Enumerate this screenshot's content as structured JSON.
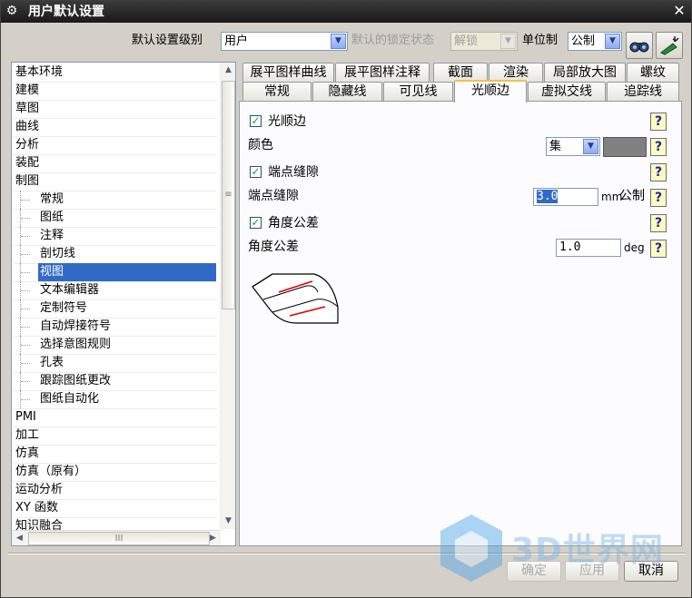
{
  "window": {
    "title": "用户默认设置",
    "close": "✕"
  },
  "toolbar": {
    "level_label": "默认设置级别",
    "level_value": "用户",
    "lock_label": "默认的锁定状态",
    "lock_value": "解锁",
    "unit_label": "单位制",
    "unit_value": "公制"
  },
  "tree": {
    "items": [
      {
        "label": "基本环境",
        "indent": 0
      },
      {
        "label": "建模",
        "indent": 0
      },
      {
        "label": "草图",
        "indent": 0
      },
      {
        "label": "曲线",
        "indent": 0
      },
      {
        "label": "分析",
        "indent": 0
      },
      {
        "label": "装配",
        "indent": 0
      },
      {
        "label": "制图",
        "indent": 0
      },
      {
        "label": "常规",
        "indent": 1
      },
      {
        "label": "图纸",
        "indent": 1
      },
      {
        "label": "注释",
        "indent": 1
      },
      {
        "label": "剖切线",
        "indent": 1
      },
      {
        "label": "视图",
        "indent": 1,
        "selected": true
      },
      {
        "label": "文本编辑器",
        "indent": 1
      },
      {
        "label": "定制符号",
        "indent": 1
      },
      {
        "label": "自动焊接符号",
        "indent": 1
      },
      {
        "label": "选择意图规则",
        "indent": 1
      },
      {
        "label": "孔表",
        "indent": 1
      },
      {
        "label": "跟踪图纸更改",
        "indent": 1
      },
      {
        "label": "图纸自动化",
        "indent": 1
      },
      {
        "label": "PMI",
        "indent": 0
      },
      {
        "label": "加工",
        "indent": 0
      },
      {
        "label": "仿真",
        "indent": 0
      },
      {
        "label": "仿真（原有）",
        "indent": 0
      },
      {
        "label": "运动分析",
        "indent": 0
      },
      {
        "label": "XY 函数",
        "indent": 0
      },
      {
        "label": "知识融合",
        "indent": 0
      }
    ]
  },
  "tabs_row1": [
    "展平图样曲线",
    "展平图样注释",
    "截面",
    "渲染",
    "局部放大图",
    "螺纹"
  ],
  "tabs_row2": [
    "常规",
    "隐藏线",
    "可见线",
    "光顺边",
    "虚拟交线",
    "追踪线"
  ],
  "active_tab": "光顺边",
  "panel": {
    "smooth_edge_checkbox": "光顺边",
    "color_label": "颜色",
    "color_select": "集",
    "color_swatch": "#808080",
    "gap_checkbox": "端点缝隙",
    "gap_label": "端点缝隙",
    "gap_value": "3.0",
    "gap_unit": "mm",
    "gap_unit_system": "公制",
    "angle_checkbox": "角度公差",
    "angle_label": "角度公差",
    "angle_value": "1.0",
    "angle_unit": "deg",
    "help_glyph": "?"
  },
  "buttons": {
    "ok": "确定",
    "apply": "应用",
    "cancel": "取消"
  },
  "watermark": "3D世界网",
  "scroll_grip": "≡",
  "hscroll_grip": "III"
}
